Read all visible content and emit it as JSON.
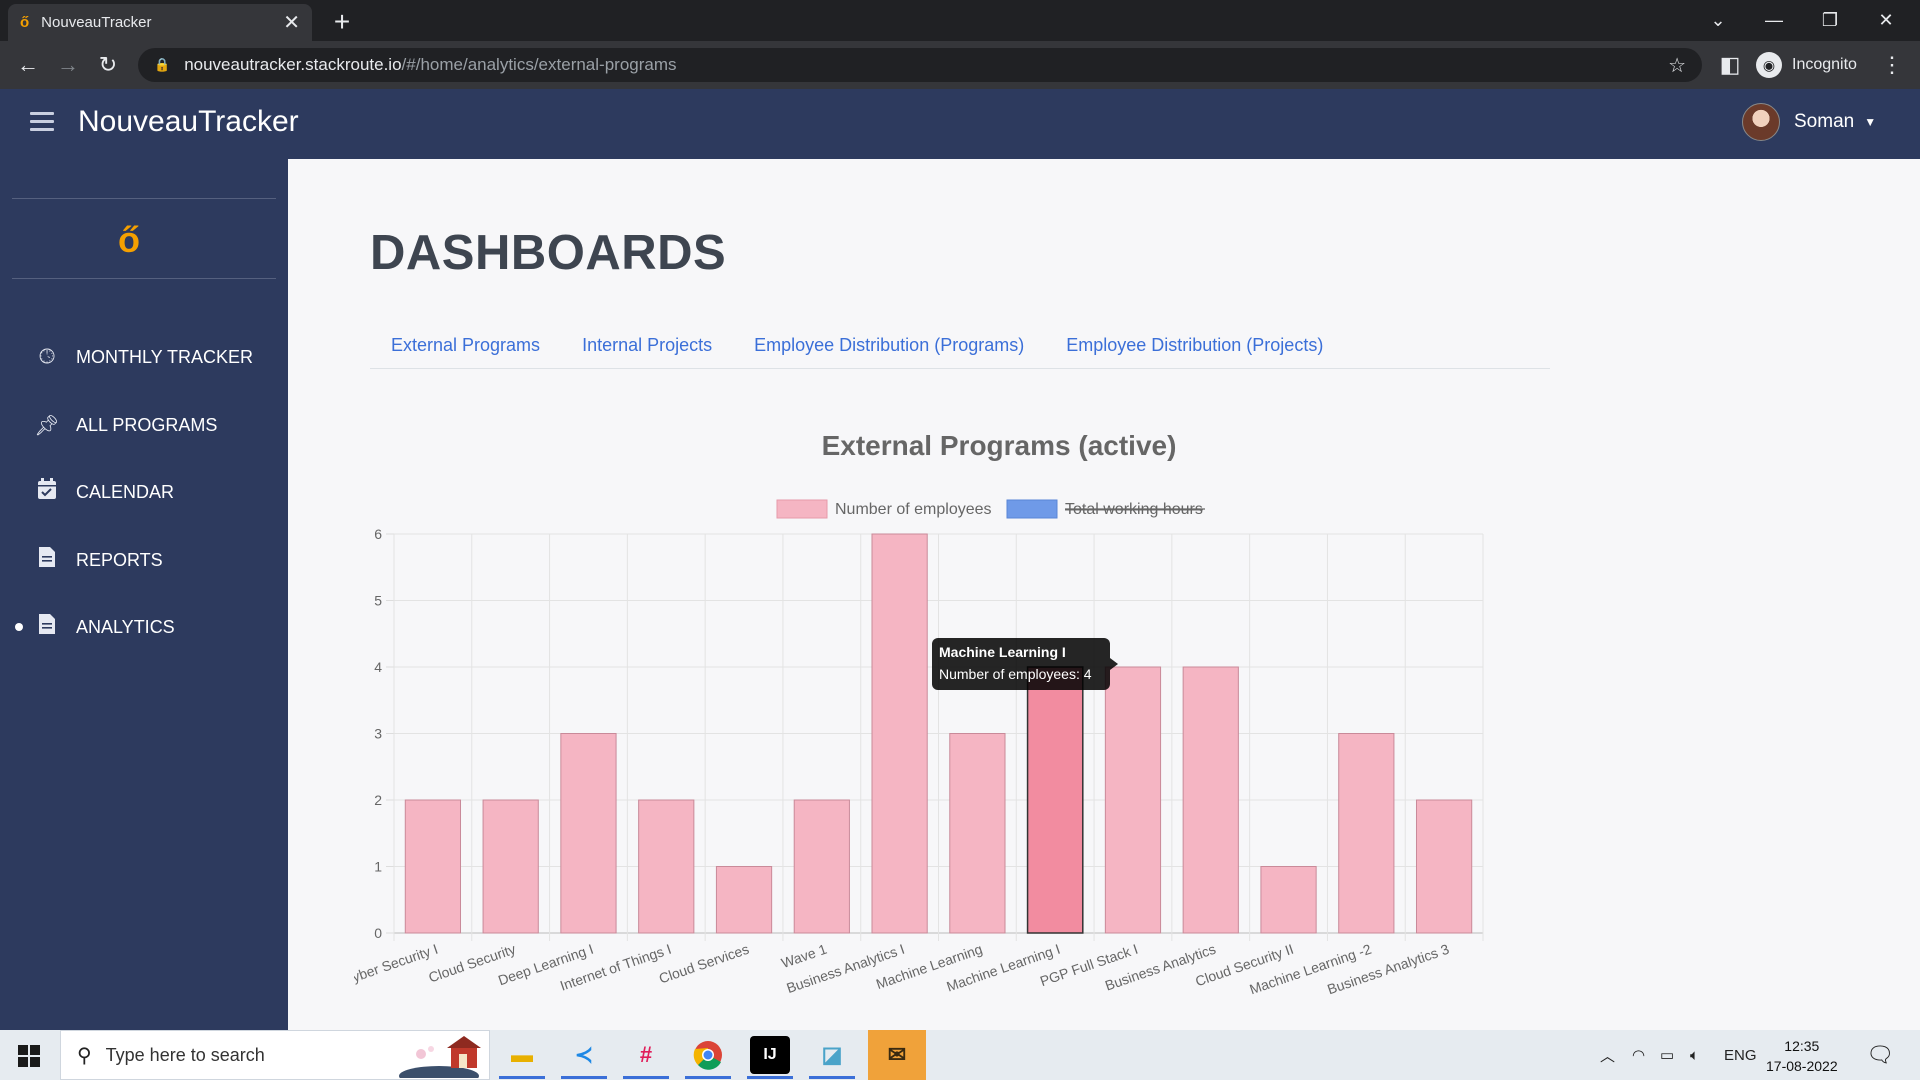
{
  "browser": {
    "tab_title": "NouveauTracker",
    "favicon": "ő",
    "url_host": "nouveautracker.stackroute.io",
    "url_path": "/#/home/analytics/external-programs",
    "profile_label": "Incognito"
  },
  "header": {
    "brand": "NouveauTracker",
    "user_name": "Soman"
  },
  "sidebar": {
    "logo": "ő",
    "items": [
      {
        "label": "MONTHLY TRACKER",
        "icon": "clock-icon"
      },
      {
        "label": "ALL PROGRAMS",
        "icon": "pin-icon"
      },
      {
        "label": "CALENDAR",
        "icon": "calendar-check-icon"
      },
      {
        "label": "REPORTS",
        "icon": "document-icon"
      },
      {
        "label": "ANALYTICS",
        "icon": "document-icon",
        "active": true
      }
    ]
  },
  "main": {
    "title": "DASHBOARDS",
    "tabs": [
      {
        "label": "External Programs"
      },
      {
        "label": "Internal Projects"
      },
      {
        "label": "Employee Distribution (Programs)"
      },
      {
        "label": "Employee Distribution (Projects)"
      }
    ]
  },
  "chart_data": {
    "type": "bar",
    "title": "External Programs (active)",
    "categories": [
      "Cyber Security I",
      "Cloud Security",
      "Deep Learning I",
      "Internet of Things I",
      "Cloud Services",
      "Wave 1",
      "Business Analytics I",
      "Machine Learning",
      "Machine Learning I",
      "PGP Full Stack I",
      "Business Analytics",
      "Cloud Security II",
      "Machine Learning -2",
      "Business Analytics 3"
    ],
    "series": [
      {
        "name": "Number of employees",
        "values": [
          2,
          2,
          3,
          2,
          1,
          2,
          6,
          3,
          4,
          4,
          4,
          1,
          3,
          2
        ],
        "color": "#f5b5c3",
        "hidden": false
      },
      {
        "name": "Total working hours",
        "values": [],
        "color": "#6f9ae8",
        "hidden": true
      }
    ],
    "ylim": [
      0,
      6
    ],
    "yticks": [
      "0",
      "1",
      "2",
      "3",
      "4",
      "5",
      "6"
    ],
    "grid": true,
    "legend": "top",
    "tooltip": {
      "title": "Machine Learning I",
      "label": "Number of employees: 4",
      "hovered_index": 8
    }
  },
  "taskbar": {
    "search_placeholder": "Type here to search",
    "language": "ENG",
    "time": "12:35",
    "date": "17-08-2022"
  }
}
